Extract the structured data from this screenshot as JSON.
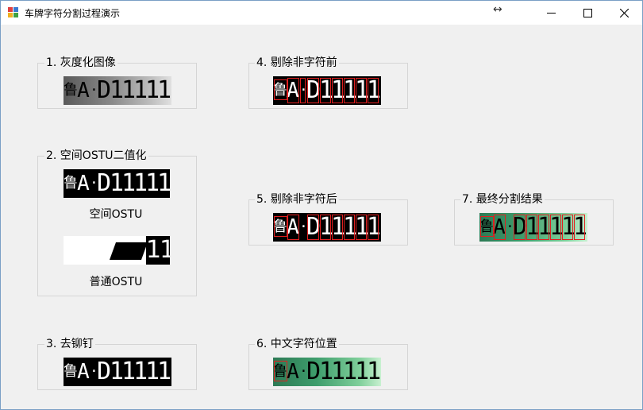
{
  "window": {
    "title": "车牌字符分割过程演示",
    "resize_glyph": "↔",
    "controls": [
      "minimize",
      "maximize",
      "close"
    ]
  },
  "groups": {
    "g1": {
      "label": "1. 灰度化图像"
    },
    "g2": {
      "label": "2. 空间OSTU二值化",
      "caption_spatial": "空间OSTU",
      "caption_normal": "普通OSTU"
    },
    "g3": {
      "label": "3. 去铆钉"
    },
    "g4": {
      "label": "4. 剔除非字符前"
    },
    "g5": {
      "label": "5. 剔除非字符后"
    },
    "g6": {
      "label": "6. 中文字符位置"
    },
    "g7": {
      "label": "7. 最终分割结果"
    }
  },
  "plate_text": {
    "province": "鲁",
    "letter": "A",
    "dot": "·",
    "serial": "D11111"
  },
  "colors": {
    "accent": "#0078d7",
    "box": "#e02020",
    "plate_green": "#3a9a6a"
  }
}
